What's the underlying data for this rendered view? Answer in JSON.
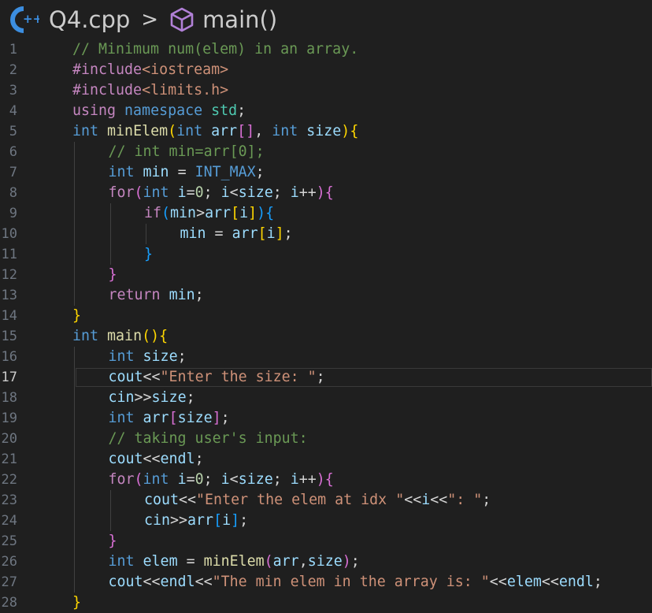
{
  "breadcrumb": {
    "file_icon": "cpp-file-icon",
    "file_name": "Q4.cpp",
    "separator": ">",
    "symbol_icon": "method-cube-icon",
    "symbol_name": "main()"
  },
  "editor": {
    "active_line": 17,
    "lines": [
      {
        "n": "1",
        "indent": 0,
        "tokens": [
          [
            "cmt",
            "// Minimum num(elem) in an array."
          ]
        ]
      },
      {
        "n": "2",
        "indent": 0,
        "tokens": [
          [
            "pre",
            "#include"
          ],
          [
            "inc",
            "<iostream>"
          ]
        ]
      },
      {
        "n": "3",
        "indent": 0,
        "tokens": [
          [
            "pre",
            "#include"
          ],
          [
            "inc",
            "<limits.h>"
          ]
        ]
      },
      {
        "n": "4",
        "indent": 0,
        "tokens": [
          [
            "ctl",
            "using"
          ],
          [
            "op",
            " "
          ],
          [
            "kw",
            "namespace"
          ],
          [
            "op",
            " "
          ],
          [
            "ns",
            "std"
          ],
          [
            "op",
            ";"
          ]
        ]
      },
      {
        "n": "5",
        "indent": 0,
        "tokens": [
          [
            "kw",
            "int"
          ],
          [
            "op",
            " "
          ],
          [
            "fn",
            "minElem"
          ],
          [
            "b1",
            "("
          ],
          [
            "kw",
            "int"
          ],
          [
            "op",
            " "
          ],
          [
            "var",
            "arr"
          ],
          [
            "b2",
            "[]"
          ],
          [
            "op",
            ", "
          ],
          [
            "kw",
            "int"
          ],
          [
            "op",
            " "
          ],
          [
            "var",
            "size"
          ],
          [
            "b1",
            ")"
          ],
          [
            "b1",
            "{"
          ]
        ]
      },
      {
        "n": "6",
        "indent": 1,
        "tokens": [
          [
            "cmt",
            "// int min=arr[0];"
          ]
        ]
      },
      {
        "n": "7",
        "indent": 1,
        "tokens": [
          [
            "kw",
            "int"
          ],
          [
            "op",
            " "
          ],
          [
            "var",
            "min"
          ],
          [
            "op",
            " = "
          ],
          [
            "mac",
            "INT_MAX"
          ],
          [
            "op",
            ";"
          ]
        ]
      },
      {
        "n": "8",
        "indent": 1,
        "tokens": [
          [
            "ctl",
            "for"
          ],
          [
            "b2",
            "("
          ],
          [
            "kw",
            "int"
          ],
          [
            "op",
            " "
          ],
          [
            "var",
            "i"
          ],
          [
            "op",
            "="
          ],
          [
            "num",
            "0"
          ],
          [
            "op",
            "; "
          ],
          [
            "var",
            "i"
          ],
          [
            "op",
            "<"
          ],
          [
            "var",
            "size"
          ],
          [
            "op",
            "; "
          ],
          [
            "var",
            "i"
          ],
          [
            "op",
            "++"
          ],
          [
            "b2",
            ")"
          ],
          [
            "b2",
            "{"
          ]
        ]
      },
      {
        "n": "9",
        "indent": 2,
        "tokens": [
          [
            "ctl",
            "if"
          ],
          [
            "b3",
            "("
          ],
          [
            "var",
            "min"
          ],
          [
            "op",
            ">"
          ],
          [
            "var",
            "arr"
          ],
          [
            "b1",
            "["
          ],
          [
            "var",
            "i"
          ],
          [
            "b1",
            "]"
          ],
          [
            "b3",
            ")"
          ],
          [
            "b3",
            "{"
          ]
        ]
      },
      {
        "n": "10",
        "indent": 3,
        "tokens": [
          [
            "var",
            "min"
          ],
          [
            "op",
            " = "
          ],
          [
            "var",
            "arr"
          ],
          [
            "b1",
            "["
          ],
          [
            "var",
            "i"
          ],
          [
            "b1",
            "]"
          ],
          [
            "op",
            ";"
          ]
        ]
      },
      {
        "n": "11",
        "indent": 2,
        "tokens": [
          [
            "b3",
            "}"
          ]
        ]
      },
      {
        "n": "12",
        "indent": 1,
        "tokens": [
          [
            "b2",
            "}"
          ]
        ]
      },
      {
        "n": "13",
        "indent": 1,
        "tokens": [
          [
            "ctl",
            "return"
          ],
          [
            "op",
            " "
          ],
          [
            "var",
            "min"
          ],
          [
            "op",
            ";"
          ]
        ]
      },
      {
        "n": "14",
        "indent": 0,
        "tokens": [
          [
            "b1",
            "}"
          ]
        ]
      },
      {
        "n": "15",
        "indent": 0,
        "tokens": [
          [
            "kw",
            "int"
          ],
          [
            "op",
            " "
          ],
          [
            "fn",
            "main"
          ],
          [
            "b1",
            "()"
          ],
          [
            "b1",
            "{"
          ]
        ]
      },
      {
        "n": "16",
        "indent": 1,
        "tokens": [
          [
            "kw",
            "int"
          ],
          [
            "op",
            " "
          ],
          [
            "var",
            "size"
          ],
          [
            "op",
            ";"
          ]
        ]
      },
      {
        "n": "17",
        "indent": 1,
        "tokens": [
          [
            "var",
            "cout"
          ],
          [
            "op",
            "<<"
          ],
          [
            "str",
            "\"Enter the size: \""
          ],
          [
            "op",
            ";"
          ]
        ]
      },
      {
        "n": "18",
        "indent": 1,
        "tokens": [
          [
            "var",
            "cin"
          ],
          [
            "op",
            ">>"
          ],
          [
            "var",
            "size"
          ],
          [
            "op",
            ";"
          ]
        ]
      },
      {
        "n": "19",
        "indent": 1,
        "tokens": [
          [
            "kw",
            "int"
          ],
          [
            "op",
            " "
          ],
          [
            "var",
            "arr"
          ],
          [
            "b2",
            "["
          ],
          [
            "var",
            "size"
          ],
          [
            "b2",
            "]"
          ],
          [
            "op",
            ";"
          ]
        ]
      },
      {
        "n": "20",
        "indent": 1,
        "tokens": [
          [
            "cmt",
            "// taking user's input:"
          ]
        ]
      },
      {
        "n": "21",
        "indent": 1,
        "tokens": [
          [
            "var",
            "cout"
          ],
          [
            "op",
            "<<"
          ],
          [
            "var",
            "endl"
          ],
          [
            "op",
            ";"
          ]
        ]
      },
      {
        "n": "22",
        "indent": 1,
        "tokens": [
          [
            "ctl",
            "for"
          ],
          [
            "b2",
            "("
          ],
          [
            "kw",
            "int"
          ],
          [
            "op",
            " "
          ],
          [
            "var",
            "i"
          ],
          [
            "op",
            "="
          ],
          [
            "num",
            "0"
          ],
          [
            "op",
            "; "
          ],
          [
            "var",
            "i"
          ],
          [
            "op",
            "<"
          ],
          [
            "var",
            "size"
          ],
          [
            "op",
            "; "
          ],
          [
            "var",
            "i"
          ],
          [
            "op",
            "++"
          ],
          [
            "b2",
            ")"
          ],
          [
            "b2",
            "{"
          ]
        ]
      },
      {
        "n": "23",
        "indent": 2,
        "tokens": [
          [
            "var",
            "cout"
          ],
          [
            "op",
            "<<"
          ],
          [
            "str",
            "\"Enter the elem at idx \""
          ],
          [
            "op",
            "<<"
          ],
          [
            "var",
            "i"
          ],
          [
            "op",
            "<<"
          ],
          [
            "str",
            "\": \""
          ],
          [
            "op",
            ";"
          ]
        ]
      },
      {
        "n": "24",
        "indent": 2,
        "tokens": [
          [
            "var",
            "cin"
          ],
          [
            "op",
            ">>"
          ],
          [
            "var",
            "arr"
          ],
          [
            "b3",
            "["
          ],
          [
            "var",
            "i"
          ],
          [
            "b3",
            "]"
          ],
          [
            "op",
            ";"
          ]
        ]
      },
      {
        "n": "25",
        "indent": 1,
        "tokens": [
          [
            "b2",
            "}"
          ]
        ]
      },
      {
        "n": "26",
        "indent": 1,
        "tokens": [
          [
            "kw",
            "int"
          ],
          [
            "op",
            " "
          ],
          [
            "var",
            "elem"
          ],
          [
            "op",
            " = "
          ],
          [
            "fn",
            "minElem"
          ],
          [
            "b2",
            "("
          ],
          [
            "var",
            "arr"
          ],
          [
            "op",
            ","
          ],
          [
            "var",
            "size"
          ],
          [
            "b2",
            ")"
          ],
          [
            "op",
            ";"
          ]
        ]
      },
      {
        "n": "27",
        "indent": 1,
        "tokens": [
          [
            "var",
            "cout"
          ],
          [
            "op",
            "<<"
          ],
          [
            "var",
            "endl"
          ],
          [
            "op",
            "<<"
          ],
          [
            "str",
            "\"The min elem in the array is: \""
          ],
          [
            "op",
            "<<"
          ],
          [
            "var",
            "elem"
          ],
          [
            "op",
            "<<"
          ],
          [
            "var",
            "endl"
          ],
          [
            "op",
            ";"
          ]
        ]
      },
      {
        "n": "28",
        "indent": 0,
        "tokens": [
          [
            "b1",
            "}"
          ]
        ]
      }
    ]
  }
}
